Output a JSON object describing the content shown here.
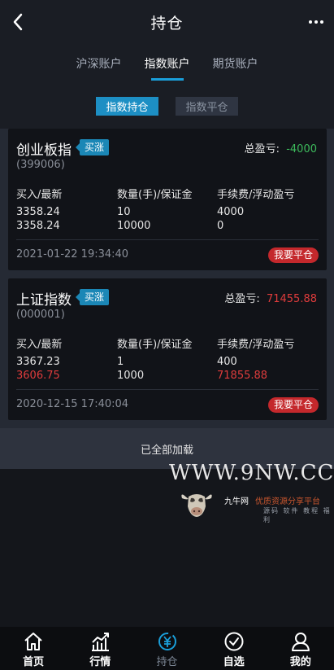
{
  "header": {
    "title": "持仓",
    "back_icon": "chevron-left-icon",
    "more_icon": "more-dots-icon"
  },
  "account_tabs": [
    {
      "label": "沪深账户",
      "active": false
    },
    {
      "label": "指数账户",
      "active": true
    },
    {
      "label": "期货账户",
      "active": false
    }
  ],
  "sub_tabs": [
    {
      "label": "指数持仓",
      "active": true
    },
    {
      "label": "指数平仓",
      "active": false
    }
  ],
  "positions": [
    {
      "name": "创业板指",
      "direction": "买涨",
      "code": "(399006)",
      "pnl_label": "总盈亏:",
      "pnl_value": "-4000",
      "pnl_color": "#3dbb5c",
      "col1_header": "买入/最新",
      "col2_header": "数量(手)/保证金",
      "col3_header": "手续费/浮动盈亏",
      "buy_price": "3358.24",
      "latest_price": "3358.24",
      "quantity": "10",
      "margin": "10000",
      "fee": "4000",
      "float_pnl": "0",
      "time": "2021-01-22 19:34:40",
      "close_label": "我要平仓"
    },
    {
      "name": "上证指数",
      "direction": "买涨",
      "code": "(000001)",
      "pnl_label": "总盈亏:",
      "pnl_value": "71455.88",
      "pnl_color": "#e03c3c",
      "col1_header": "买入/最新",
      "col2_header": "数量(手)/保证金",
      "col3_header": "手续费/浮动盈亏",
      "buy_price": "3367.23",
      "latest_price": "3606.75",
      "quantity": "1",
      "margin": "1000",
      "fee": "400",
      "float_pnl": "71855.88",
      "time": "2020-12-15 17:40:04",
      "close_label": "我要平仓"
    }
  ],
  "load_status": "已全部加载",
  "watermark": {
    "url": "WWW.9NW.CC",
    "name": "九牛网",
    "slogan": "优质资源分享平台",
    "sub": "源码 软件 教程 福利"
  },
  "tabbar": [
    {
      "label": "首页",
      "icon": "home-icon",
      "active": false
    },
    {
      "label": "行情",
      "icon": "chart-icon",
      "active": false
    },
    {
      "label": "持仓",
      "icon": "yen-icon",
      "active": true
    },
    {
      "label": "自选",
      "icon": "check-circle-icon",
      "active": false
    },
    {
      "label": "我的",
      "icon": "user-icon",
      "active": false
    }
  ],
  "colors": {
    "accent": "#1a9ed9",
    "up": "#e03c3c",
    "down": "#3dbb5c",
    "close_button": "#c4282c"
  }
}
